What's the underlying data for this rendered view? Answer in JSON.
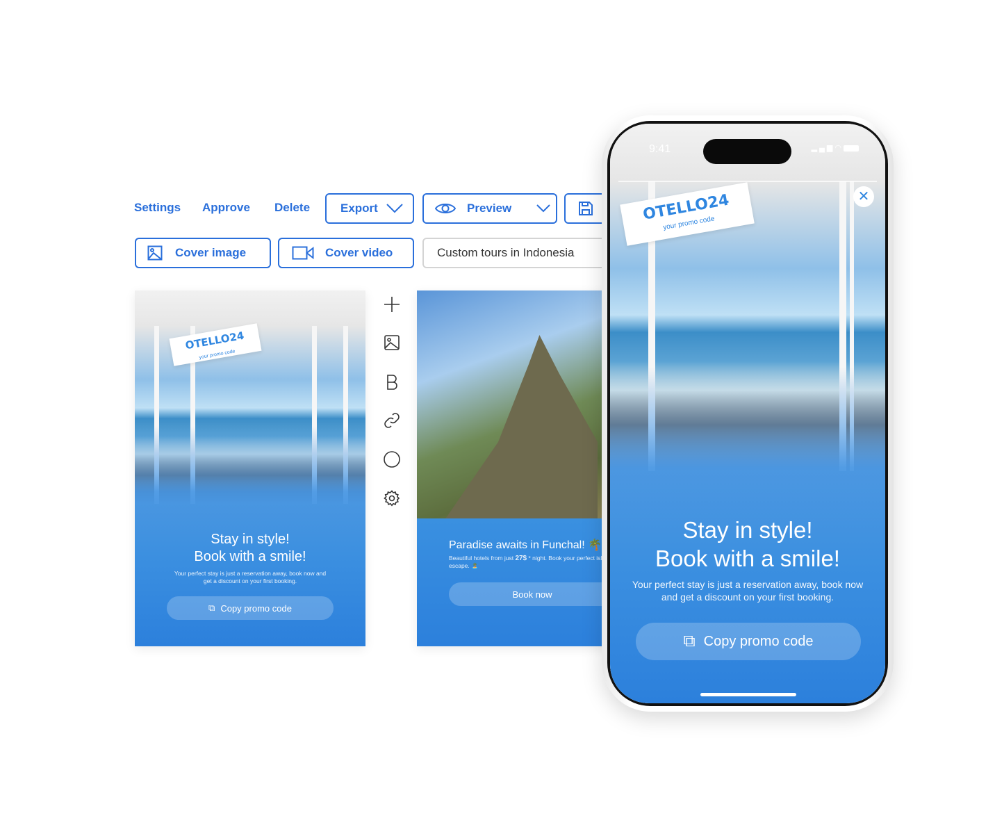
{
  "toolbar": {
    "settings": "Settings",
    "approve": "Approve",
    "delete": "Delete",
    "export": "Export",
    "preview": "Preview",
    "save_icon": "floppy-disk-icon"
  },
  "media": {
    "cover_image": "Cover image",
    "cover_video": "Cover video",
    "title_value": "Custom tours in Indonesia"
  },
  "tools": [
    "plus-icon",
    "image-icon",
    "bold-icon",
    "link-icon",
    "circle-icon",
    "gear-icon"
  ],
  "card1": {
    "promo_code": "OTELLO24",
    "promo_sub": "your promo code",
    "title_line1": "Stay in style!",
    "title_line2": "Book with a smile!",
    "body": "Your perfect stay is just a reservation away, book now and get a discount on your first booking.",
    "button": "Copy promo code"
  },
  "card2": {
    "title": "Paradise awaits in Funchal! 🌴",
    "body_prefix": "Beautiful hotels from just ",
    "price": "27$",
    "body_suffix": " * night. Book your perfect island escape. 🏝️",
    "button": "Book now"
  },
  "phone": {
    "time": "9:41",
    "promo_code": "OTELLO24",
    "promo_sub": "your promo code",
    "title_line1": "Stay in style!",
    "title_line2": "Book with a smile!",
    "body": "Your perfect stay is just a reservation away, book now and get a discount on your first booking.",
    "button": "Copy promo code"
  },
  "colors": {
    "accent": "#2a6fdb",
    "story_blue": "#3b8fe0"
  }
}
